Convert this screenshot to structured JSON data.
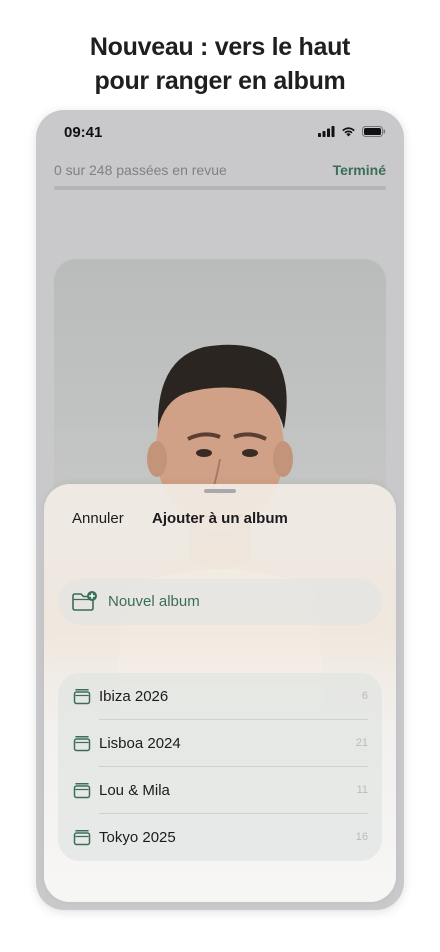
{
  "promo": {
    "headline_line1": "Nouveau : vers le haut",
    "headline_line2": "pour ranger en album"
  },
  "status_bar": {
    "time": "09:41",
    "icons": [
      "signal-icon",
      "wifi-icon",
      "battery-icon"
    ]
  },
  "review": {
    "progress_text": "0 sur 248 passées en revue",
    "done_label": "Terminé",
    "progress_fraction": 0
  },
  "sheet": {
    "cancel_label": "Annuler",
    "title": "Ajouter à un album",
    "new_album_label": "Nouvel album",
    "new_album_icon": "folder-add-icon",
    "albums": [
      {
        "name": "Ibiza 2026",
        "count": "6",
        "icon": "stack-icon"
      },
      {
        "name": "Lisboa 2024",
        "count": "21",
        "icon": "stack-icon"
      },
      {
        "name": "Lou & Mila",
        "count": "11",
        "icon": "stack-icon"
      },
      {
        "name": "Tokyo 2025",
        "count": "16",
        "icon": "stack-icon"
      }
    ]
  },
  "colors": {
    "accent": "#3c6e57",
    "background": "#ffffff",
    "phone_bg": "#c9c9cc"
  }
}
